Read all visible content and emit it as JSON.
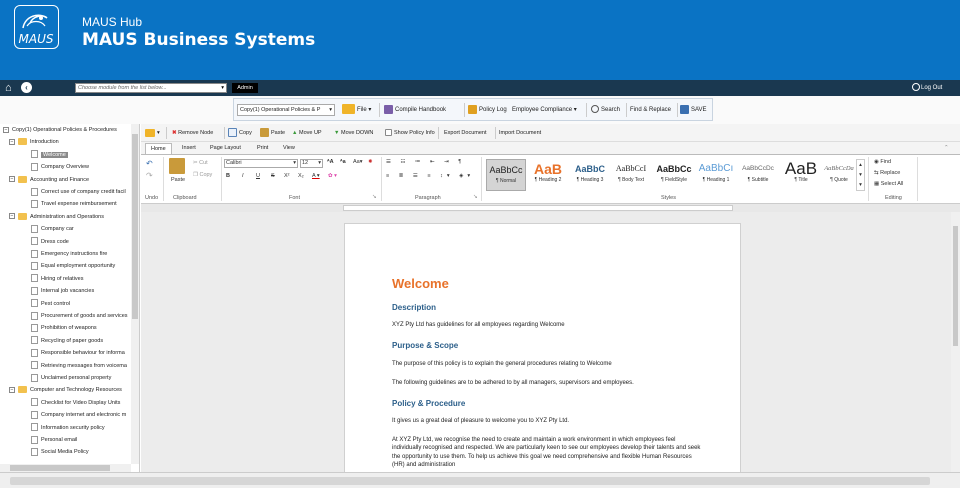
{
  "header": {
    "logo_text": "MAUS",
    "hub": "MAUS Hub",
    "title": "MAUS Business Systems"
  },
  "nav": {
    "module_placeholder": "Choose module from the list below...",
    "admin": "Admin",
    "logout": "Log Out"
  },
  "toolbar": {
    "doc_select": "Copy(1) Operational Policies & P",
    "file": "File",
    "compile": "Compile Handbook",
    "policy_log": "Policy Log",
    "compliance": "Employee Compliance",
    "search": "Search",
    "find_replace": "Find & Replace",
    "save": "SAVE"
  },
  "tree": [
    {
      "label": "Copy(1) Operational Policies & Procedures",
      "level": 0,
      "type": "root"
    },
    {
      "label": "Introduction",
      "level": 1,
      "type": "folder"
    },
    {
      "label": "Welcome",
      "level": 2,
      "type": "doc",
      "selected": true
    },
    {
      "label": "Company Overview",
      "level": 2,
      "type": "doc"
    },
    {
      "label": "Accounting and Finance",
      "level": 1,
      "type": "folder"
    },
    {
      "label": "Correct use of company credit facil",
      "level": 2,
      "type": "doc"
    },
    {
      "label": "Travel expense reimbursement",
      "level": 2,
      "type": "doc"
    },
    {
      "label": "Administration and Operations",
      "level": 1,
      "type": "folder"
    },
    {
      "label": "Company car",
      "level": 2,
      "type": "doc"
    },
    {
      "label": "Dress code",
      "level": 2,
      "type": "doc"
    },
    {
      "label": "Emergency instructions fire",
      "level": 2,
      "type": "doc"
    },
    {
      "label": "Equal employment opportunity",
      "level": 2,
      "type": "doc"
    },
    {
      "label": "Hiring of relatives",
      "level": 2,
      "type": "doc"
    },
    {
      "label": "Internal job vacancies",
      "level": 2,
      "type": "doc"
    },
    {
      "label": "Pest control",
      "level": 2,
      "type": "doc"
    },
    {
      "label": "Procurement of goods and services",
      "level": 2,
      "type": "doc"
    },
    {
      "label": "Prohibition of weapons",
      "level": 2,
      "type": "doc"
    },
    {
      "label": "Recycling of paper goods",
      "level": 2,
      "type": "doc"
    },
    {
      "label": "Responsible behaviour for informa",
      "level": 2,
      "type": "doc"
    },
    {
      "label": "Retrieving messages from voicema",
      "level": 2,
      "type": "doc"
    },
    {
      "label": "Unclaimed personal property",
      "level": 2,
      "type": "doc"
    },
    {
      "label": "Computer and Technology Resources",
      "level": 1,
      "type": "folder"
    },
    {
      "label": "Checklist for Video Display Units",
      "level": 2,
      "type": "doc"
    },
    {
      "label": "Company internet and electronic m",
      "level": 2,
      "type": "doc"
    },
    {
      "label": "Information security policy",
      "level": 2,
      "type": "doc"
    },
    {
      "label": "Personal email",
      "level": 2,
      "type": "doc"
    },
    {
      "label": "Social Media Policy",
      "level": 2,
      "type": "doc"
    }
  ],
  "node_bar": {
    "remove": "Remove Node",
    "copy": "Copy",
    "paste": "Paste",
    "move_up": "Move UP",
    "move_down": "Move DOWN",
    "show_info": "Show Policy Info",
    "export": "Export Document",
    "import": "Import Document"
  },
  "tabs": [
    "Home",
    "Insert",
    "Page Layout",
    "Print",
    "View"
  ],
  "ribbon": {
    "undo": "Undo",
    "paste": "Paste",
    "cut": "Cut",
    "copy": "Copy",
    "clipboard": "Clipboard",
    "font_name": "Calibri",
    "font_size": "12",
    "font": "Font",
    "paragraph": "Paragraph",
    "styles_label": "Styles",
    "editing": "Editing",
    "find": "Find",
    "replace": "Replace",
    "select_all": "Select All",
    "styles": [
      {
        "sample": "AaBbCc",
        "name": "¶ Normal",
        "selected": true
      },
      {
        "sample": "AaB",
        "name": "¶ Heading 2"
      },
      {
        "sample": "AaBbC",
        "name": "¶ Heading 3"
      },
      {
        "sample": "AaBbCcI",
        "name": "¶ Body Text"
      },
      {
        "sample": "AaBbCc",
        "name": "¶ FieldStyle"
      },
      {
        "sample": "AaBbCı",
        "name": "¶ Heading 1"
      },
      {
        "sample": "AaBbCcDc",
        "name": "¶ Subtitle"
      },
      {
        "sample": "AaB",
        "name": "¶ Title"
      },
      {
        "sample": "AaBbCcDa",
        "name": "¶ Quote"
      }
    ]
  },
  "document": {
    "title": "Welcome",
    "h_description": "Description",
    "p_description": "XYZ Pty Ltd has guidelines for all employees regarding Welcome",
    "h_purpose": "Purpose & Scope",
    "p_purpose_1": "The purpose of this policy is to explain the general procedures relating to Welcome",
    "p_purpose_2": "The following guidelines are to be adhered to by all managers, supervisors and employees.",
    "h_policy": "Policy & Procedure",
    "p_policy_1": "It gives us a great deal of pleasure to welcome you to XYZ Pty Ltd.",
    "p_policy_2": "At XYZ Pty Ltd, we recognise the need to create and maintain a work environment in which employees feel individually recognised and respected. We are particularly keen to see our employees develop their talents and seek the opportunity to use them.  To help us achieve this goal we need comprehensive and flexible Human Resources (HR) and administration"
  },
  "colors": {
    "header_blue": "#0a73c4",
    "nav_dark": "#1a3850",
    "title_orange": "#e8722a",
    "heading_blue": "#2c5f8a"
  }
}
